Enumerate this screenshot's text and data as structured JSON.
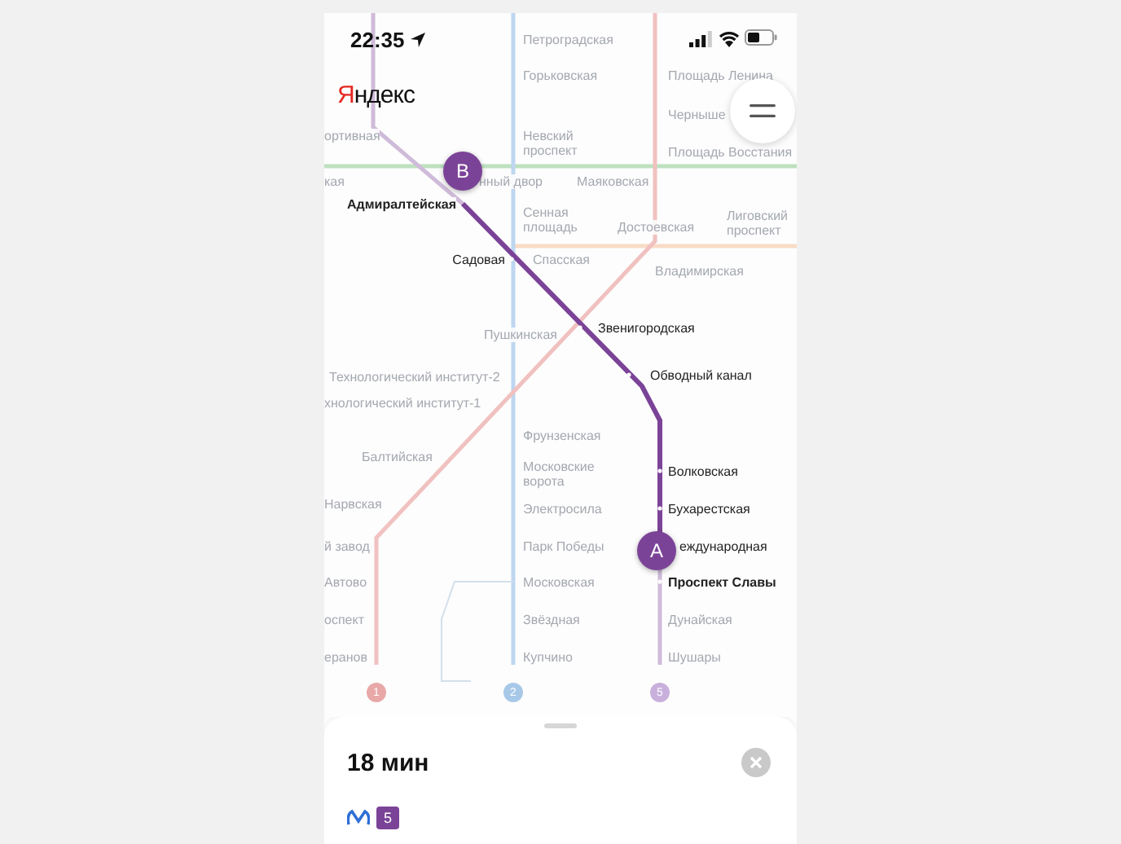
{
  "status_bar": {
    "time": "22:35"
  },
  "logo": "Яндекс",
  "map": {
    "stations": [
      {
        "name": "Петроградская",
        "kind": "faded"
      },
      {
        "name": "Горьковская",
        "kind": "faded"
      },
      {
        "name": "Площадь Ленина",
        "kind": "faded"
      },
      {
        "name": "Черныше",
        "kind": "faded"
      },
      {
        "name": "ортивная",
        "kind": "faded"
      },
      {
        "name": "Невский проспект",
        "kind": "faded"
      },
      {
        "name": "Площадь Восстания",
        "kind": "faded"
      },
      {
        "name": "кая",
        "kind": "faded"
      },
      {
        "name": "нный двор",
        "kind": "faded"
      },
      {
        "name": "Маяковская",
        "kind": "faded"
      },
      {
        "name": "Адмиралтейская",
        "kind": "endpoint"
      },
      {
        "name": "Сенная площадь",
        "kind": "faded"
      },
      {
        "name": "Достоевская",
        "kind": "faded"
      },
      {
        "name": "Лиговский проспект",
        "kind": "faded"
      },
      {
        "name": "Садовая",
        "kind": "route"
      },
      {
        "name": "Спасская",
        "kind": "faded"
      },
      {
        "name": "Владимирская",
        "kind": "faded"
      },
      {
        "name": "Пушкинская",
        "kind": "faded"
      },
      {
        "name": "Звенигородская",
        "kind": "route"
      },
      {
        "name": "Технологический институт-2",
        "kind": "faded"
      },
      {
        "name": "Обводный канал",
        "kind": "route"
      },
      {
        "name": "хнологический институт-1",
        "kind": "faded"
      },
      {
        "name": "Фрунзенская",
        "kind": "faded"
      },
      {
        "name": "Балтийская",
        "kind": "faded"
      },
      {
        "name": "Московские ворота",
        "kind": "faded"
      },
      {
        "name": "Волковская",
        "kind": "route"
      },
      {
        "name": "Нарвская",
        "kind": "faded"
      },
      {
        "name": "Электросила",
        "kind": "faded"
      },
      {
        "name": "Бухарестская",
        "kind": "route"
      },
      {
        "name": "й завод",
        "kind": "faded"
      },
      {
        "name": "Парк Победы",
        "kind": "faded"
      },
      {
        "name": "еждународная",
        "kind": "route"
      },
      {
        "name": "Автово",
        "kind": "faded"
      },
      {
        "name": "Московская",
        "kind": "faded"
      },
      {
        "name": "Проспект Славы",
        "kind": "endpoint"
      },
      {
        "name": "оспект",
        "kind": "faded"
      },
      {
        "name": "Звёздная",
        "kind": "faded"
      },
      {
        "name": "Дунайская",
        "kind": "faded"
      },
      {
        "name": "еранов",
        "kind": "faded"
      },
      {
        "name": "Купчино",
        "kind": "faded"
      },
      {
        "name": "Шушары",
        "kind": "faded"
      }
    ],
    "markers": [
      {
        "label": "B"
      },
      {
        "label": "A"
      }
    ],
    "line_badges": [
      {
        "label": "1",
        "color": "#e8a8a8"
      },
      {
        "label": "2",
        "color": "#a8c8e8"
      },
      {
        "label": "5",
        "color": "#c9b0dc"
      }
    ]
  },
  "route_sheet": {
    "duration": "18 мин",
    "line_badge": {
      "label": "5",
      "color": "#7b4397"
    }
  }
}
